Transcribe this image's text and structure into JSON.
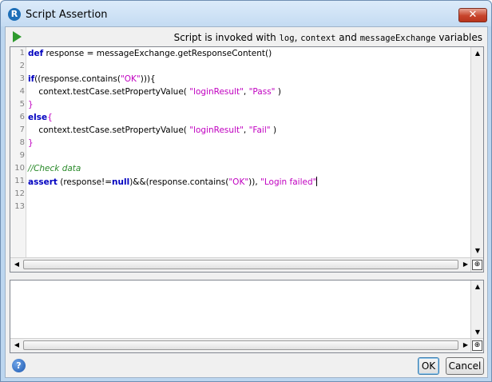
{
  "window": {
    "title": "Script Assertion",
    "close_label": "✕"
  },
  "toolbar": {
    "info_prefix": "Script is invoked with ",
    "var1": "log",
    "sep1": ", ",
    "var2": "context",
    "sep2": " and ",
    "var3": "messageExchange",
    "suffix": " variables"
  },
  "editor": {
    "line_numbers": [
      "1",
      "2",
      "3",
      "4",
      "5",
      "6",
      "7",
      "8",
      "9",
      "10",
      "11",
      "12",
      "13"
    ],
    "code": {
      "l1_kw": "def",
      "l1_rest": " response = messageExchange.getResponseContent()",
      "l3_kw": "if",
      "l3_a": "((response.contains(",
      "l3_str": "\"OK\"",
      "l3_b": "))){",
      "l4_a": "    context.testCase.setPropertyValue( ",
      "l4_s1": "\"loginResult\"",
      "l4_b": ", ",
      "l4_s2": "\"Pass\"",
      "l4_c": " )",
      "l5": "}",
      "l6_kw": "else",
      "l6_rest": "{",
      "l7_a": "    context.testCase.setPropertyValue( ",
      "l7_s1": "\"loginResult\"",
      "l7_b": ", ",
      "l7_s2": "\"Fail\"",
      "l7_c": " )",
      "l8": "}",
      "l10": "//Check data",
      "l11_kw": "assert",
      "l11_a": " (response!=",
      "l11_null": "null",
      "l11_b": ")&&(response.contains(",
      "l11_s1": "\"OK\"",
      "l11_c": ")), ",
      "l11_s2": "\"Login failed\""
    }
  },
  "log": {
    "text": ""
  },
  "buttons": {
    "ok": "OK",
    "cancel": "Cancel",
    "help": "?"
  },
  "icons": {
    "app": "soapui-icon",
    "run": "play-icon",
    "help": "help-icon",
    "zoom": "zoom-icon"
  }
}
